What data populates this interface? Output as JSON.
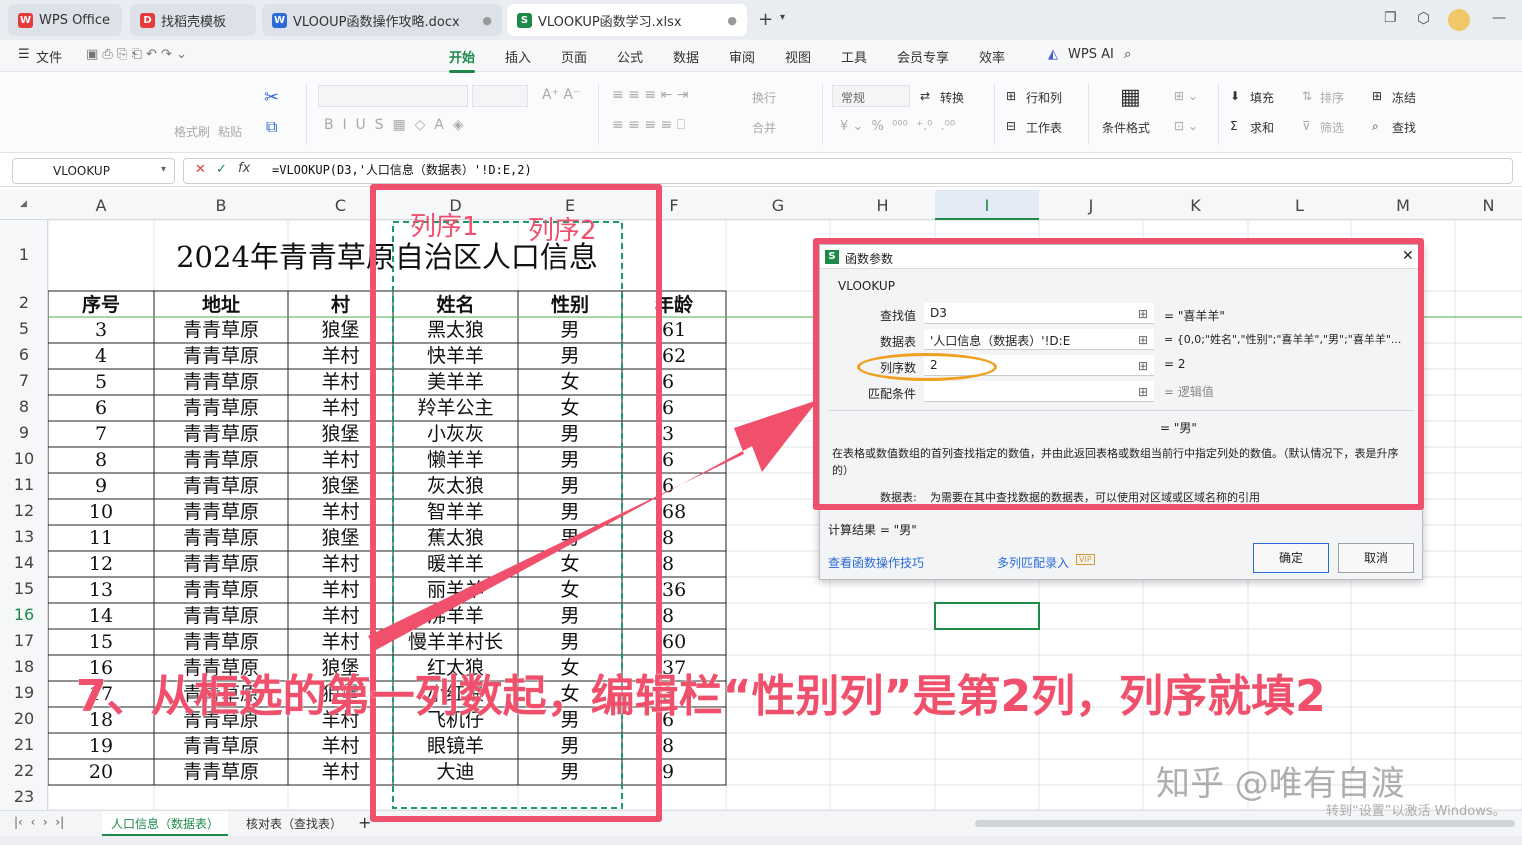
{
  "tabs": [
    {
      "label": "WPS Office"
    },
    {
      "label": "找稻壳模板"
    },
    {
      "label": "VLOOUP函数操作攻略.docx"
    },
    {
      "label": "VLOOKUP函数学习.xlsx"
    }
  ],
  "menu": {
    "file": "文件",
    "items": [
      "开始",
      "插入",
      "页面",
      "公式",
      "数据",
      "审阅",
      "视图",
      "工具",
      "会员专享",
      "效率"
    ],
    "wpsai": "WPS AI"
  },
  "ribbon": {
    "format_brush": "格式刷",
    "paste": "粘贴",
    "wrap": "换行",
    "merge": "合并",
    "number_format": "常规",
    "convert": "转换",
    "rows_cols": "行和列",
    "worksheet": "工作表",
    "cond_format": "条件格式",
    "fill": "填充",
    "sort": "排序",
    "filter": "筛选",
    "freeze": "冻结",
    "sum": "求和",
    "find": "查找"
  },
  "formula_bar": {
    "name_box": "VLOOKUP",
    "formula": "=VLOOKUP(D3,'人口信息（数据表）'!D:E,2)"
  },
  "columns": [
    "A",
    "B",
    "C",
    "D",
    "E",
    "F",
    "G",
    "H",
    "I",
    "J",
    "K",
    "L",
    "M",
    "N"
  ],
  "sheet": {
    "title": "2024年青青草原自治区人口信息",
    "headers": [
      "序号",
      "地址",
      "村",
      "姓名",
      "性别",
      "年龄"
    ],
    "row_numbers": [
      "1",
      "2",
      "5",
      "6",
      "7",
      "8",
      "9",
      "10",
      "11",
      "12",
      "13",
      "14",
      "15",
      "16",
      "17",
      "18",
      "19",
      "20",
      "21",
      "22",
      "23"
    ],
    "rows": [
      [
        "3",
        "青青草原",
        "狼堡",
        "黑太狼",
        "男",
        "61"
      ],
      [
        "4",
        "青青草原",
        "羊村",
        "快羊羊",
        "男",
        "62"
      ],
      [
        "5",
        "青青草原",
        "羊村",
        "美羊羊",
        "女",
        "6"
      ],
      [
        "6",
        "青青草原",
        "羊村",
        "羚羊公主",
        "女",
        "6"
      ],
      [
        "7",
        "青青草原",
        "狼堡",
        "小灰灰",
        "男",
        "3"
      ],
      [
        "8",
        "青青草原",
        "羊村",
        "懒羊羊",
        "男",
        "6"
      ],
      [
        "9",
        "青青草原",
        "狼堡",
        "灰太狼",
        "男",
        "6"
      ],
      [
        "10",
        "青青草原",
        "羊村",
        "智羊羊",
        "男",
        "68"
      ],
      [
        "11",
        "青青草原",
        "狼堡",
        "蕉太狼",
        "男",
        "8"
      ],
      [
        "12",
        "青青草原",
        "羊村",
        "暖羊羊",
        "女",
        "8"
      ],
      [
        "13",
        "青青草原",
        "羊村",
        "丽羊羊",
        "女",
        "36"
      ],
      [
        "14",
        "青青草原",
        "羊村",
        "沸羊羊",
        "男",
        "8"
      ],
      [
        "15",
        "青青草原",
        "羊村",
        "慢羊羊村长",
        "男",
        "60"
      ],
      [
        "16",
        "青青草原",
        "狼堡",
        "红太狼",
        "女",
        "37"
      ],
      [
        "17",
        "青青草原",
        "狼堡",
        "小红狼",
        "女",
        "3"
      ],
      [
        "18",
        "青青草原",
        "羊村",
        "飞机仔",
        "男",
        "6"
      ],
      [
        "19",
        "青青草原",
        "羊村",
        "眼镜羊",
        "男",
        "8"
      ],
      [
        "20",
        "青青草原",
        "羊村",
        "大迪",
        "男",
        "9"
      ]
    ]
  },
  "dialog": {
    "title": "函数参数",
    "func": "VLOOKUP",
    "lookup_label": "查找值",
    "lookup_value": "D3",
    "lookup_result": "= \"喜羊羊\"",
    "table_label": "数据表",
    "table_value": "'人口信息（数据表）'!D:E",
    "table_result": "= {0,0;\"姓名\",\"性别\";\"喜羊羊\",\"男\";\"喜羊羊\"...",
    "col_label": "列序数",
    "col_value": "2",
    "col_result": "= 2",
    "match_label": "匹配条件",
    "match_value": "",
    "match_result": "= 逻辑值",
    "overall_result": "= \"男\"",
    "description": "在表格或数值数组的首列查找指定的数值，并由此返回表格或数组当前行中指定列处的数值。（默认情况下，表是升序的）",
    "param_label": "数据表:",
    "param_desc": "为需要在其中查找数据的数据表，可以使用对区域或区域名称的引用",
    "calc_result": "计算结果 = \"男\"",
    "tips_link": "查看函数操作技巧",
    "multi_link": "多列匹配录入",
    "ok": "确定",
    "cancel": "取消"
  },
  "sheet_tabs": [
    "人口信息（数据表）",
    "核对表（查找表）"
  ],
  "annotations": {
    "col1": "列序1",
    "col2": "列序2",
    "caption": "7、从框选的第一列数起，编辑栏“性别列”是第2列，列序就填2"
  },
  "watermark": "知乎 @唯有自渡",
  "activation": "转到“设置”以激活 Windows。",
  "colors": {
    "accent": "#1d8a4a",
    "annotation": "#f0506b",
    "orange": "#f0a020"
  }
}
